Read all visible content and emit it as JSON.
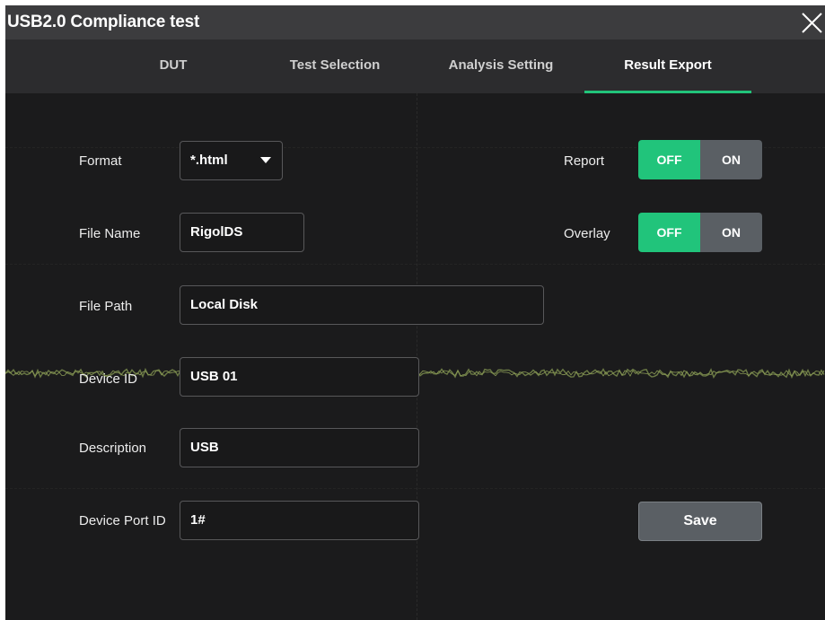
{
  "window": {
    "title": "USB2.0 Compliance test"
  },
  "tabs": [
    {
      "label": "DUT",
      "active": false
    },
    {
      "label": "Test Selection",
      "active": false
    },
    {
      "label": "Analysis Setting",
      "active": false
    },
    {
      "label": "Result Export",
      "active": true
    }
  ],
  "form": {
    "format": {
      "label": "Format",
      "value": "*.html"
    },
    "file_name": {
      "label": "File Name",
      "value": "RigolDS"
    },
    "file_path": {
      "label": "File Path",
      "value": "Local Disk"
    },
    "device_id": {
      "label": "Device ID",
      "value": "USB 01"
    },
    "description": {
      "label": "Description",
      "value": "USB"
    },
    "device_port_id": {
      "label": "Device Port ID",
      "value": "1#"
    }
  },
  "toggles": {
    "report": {
      "label": "Report",
      "off_label": "OFF",
      "on_label": "ON",
      "selected": "OFF"
    },
    "overlay": {
      "label": "Overlay",
      "off_label": "OFF",
      "on_label": "ON",
      "selected": "OFF"
    }
  },
  "save_button": {
    "label": "Save"
  },
  "colors": {
    "accent": "#22c47a",
    "titlebar": "#3c3c3e",
    "tabbar": "#2c2c2e",
    "background": "#1b1b1c",
    "button_gray": "#5a5f64",
    "waveform": "#6b7a45"
  },
  "icons": {
    "close": "close-icon",
    "dropdown": "chevron-down-icon"
  }
}
